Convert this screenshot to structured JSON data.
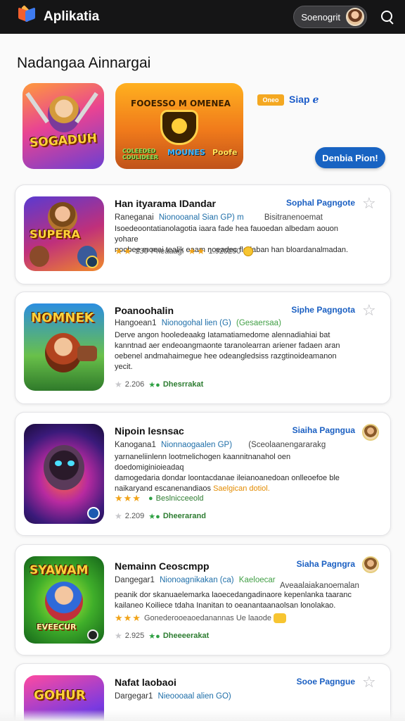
{
  "app": {
    "title": "Aplikatia"
  },
  "header": {
    "user_label": "Soenogrit"
  },
  "page": {
    "title": "Nadangaa Ainnargai"
  },
  "featured": {
    "tile1_word": "SOGADUH",
    "tile2_top": "FOOESSO M OMENEA",
    "tile2_bottom_left": "COLEEDED COULIDEER",
    "tile2_bottom_mid": "MOUNES",
    "tile2_bottom_right": "Poofe",
    "badge": "Oneo",
    "link": "Siap ℯ",
    "button": "Denbia Pion!"
  },
  "cards": [
    {
      "title": "Han ityarama IDandar",
      "link": "Sophal Pagngote",
      "developer": "Raneganai",
      "tag": "Nionooanal Sian GP) m",
      "tag_right": "Bisitranenoemat",
      "desc1": "Isoedeoontatianolagotia iaara fade hea fauoedan albedam aouon yohare",
      "desc2": "noobee moeai tealik eaam noeadec fledaban han bloardanalmadan.",
      "rating_a": "★★",
      "rating_a_count": "230",
      "rating_a_text": "Pheaaagi",
      "rating_b": "★★",
      "rating_b_text": "1.920290",
      "icon_word": "SUPERA"
    },
    {
      "title": "Poanoohalin",
      "link": "Siphe Pagngota",
      "developer": "Hangoean1",
      "tag": "Nionogohal lien (G)",
      "tag_green": "(Gesaersaa)",
      "desc1": "Derve angon hooledeaakg Iatamatiamedome alennadiahiai bat",
      "desc2": "kanntnad aer endeoangmaonte taranolearran ariener fadaen aran",
      "desc3": "oebenel andmahaimegue hee odeangledsiss razgtinoideamanon",
      "desc4": "yecit.",
      "rating_count": "2.206",
      "status": "Dhesrrakat",
      "icon_word": "NOMNEK"
    },
    {
      "title": "Nipoin lesnsac",
      "link": "Siaiha Pagngua",
      "developer": "Kanogana1",
      "tag": "Nionnaogaalen GP)",
      "tag_right": "(Sceolaanengararakg",
      "desc1": "yarnaneliinlenn lootmelichogen kaannitnanahol oen doedomiginioieadaq",
      "desc2": "damogedaria dondar loontacdanae ileianoanedoan onlleoefoe ble",
      "desc3": "naikaryand escanenandiaos",
      "desc3_hl": "Saelgican dotiol.",
      "rating_a": "★★★",
      "rating_a_text": "Beslnicceeold",
      "rating_count": "2.209",
      "status": "Dheerarand",
      "icon_word": ""
    },
    {
      "title": "Nemainn Ceoscmpp",
      "link": "Siaha Pagngra",
      "developer": "Dangegar1",
      "tag": "Nionoagnikakan (ca)",
      "tag_green": "Kaeloecar",
      "tag_right": "Aveaalaiakanoemalan",
      "desc1": "peanik dor skanuaelemarka laoecedangadinaore kepenlanka taaranc",
      "desc2": "kailaneo Koiliece tdaha Inanitan to oeanantaanaolsan lonolakao.",
      "rating_a": "★★★",
      "rating_a_text": "Gonederooeaoedanannas Ue laaode",
      "rating_count": "2.925",
      "status": "Dheeeerakat",
      "icon_word": "SYAWAM",
      "icon_word2": "EVEECUR"
    },
    {
      "title": "Nafat laobaoi",
      "link": "Sooe Pagngue",
      "developer": "Dargegar1",
      "tag": "Nieoooaal alien GO)",
      "icon_word": "GOHUR"
    }
  ]
}
